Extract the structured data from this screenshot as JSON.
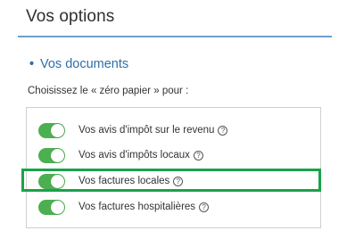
{
  "header": {
    "title": "Vos options"
  },
  "section": {
    "bullet": "•",
    "heading": "Vos documents"
  },
  "instruction": "Choisissez le « zéro papier » pour :",
  "options": [
    {
      "label": "Vos avis d'impôt sur le revenu",
      "enabled": true,
      "help": "?"
    },
    {
      "label": "Vos avis d'impôts locaux",
      "enabled": true,
      "help": "?"
    },
    {
      "label": "Vos factures locales",
      "enabled": true,
      "help": "?"
    },
    {
      "label": "Vos factures hospitalières",
      "enabled": true,
      "help": "?"
    }
  ],
  "colors": {
    "toggle_on": "#4caf50",
    "highlight": "#1aa24b",
    "accent": "#2f6fa8",
    "rule": "#6f9fc9"
  }
}
